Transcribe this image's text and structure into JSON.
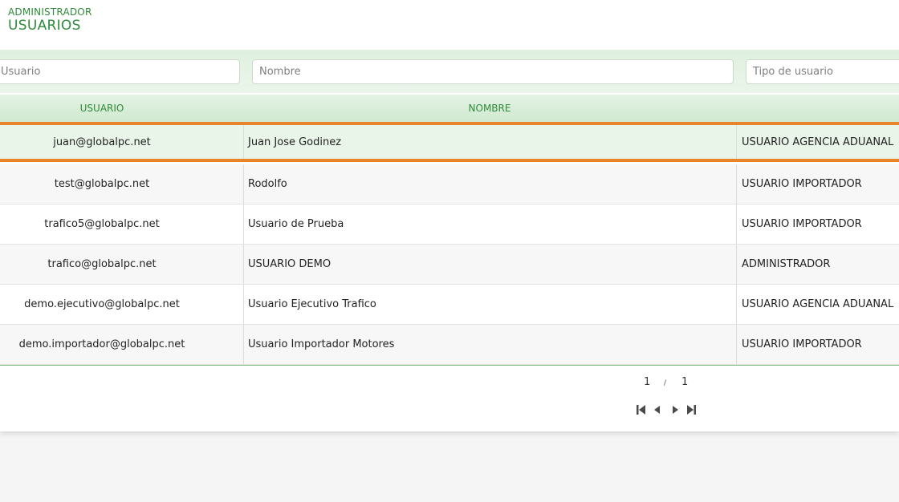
{
  "header": {
    "section": "ADMINISTRADOR",
    "title": "USUARIOS"
  },
  "filters": {
    "usuario_placeholder": "Usuario",
    "nombre_placeholder": "Nombre",
    "tipo_placeholder": "Tipo de usuario"
  },
  "table": {
    "columns": {
      "usuario": "USUARIO",
      "nombre": "NOMBRE"
    },
    "rows": [
      {
        "usuario": "juan@globalpc.net",
        "nombre": "Juan Jose Godinez",
        "tipo": "USUARIO AGENCIA ADUANAL",
        "selected": true
      },
      {
        "usuario": "test@globalpc.net",
        "nombre": "Rodolfo",
        "tipo": "USUARIO IMPORTADOR"
      },
      {
        "usuario": "trafico5@globalpc.net",
        "nombre": "Usuario de Prueba",
        "tipo": "USUARIO IMPORTADOR"
      },
      {
        "usuario": "trafico@globalpc.net",
        "nombre": "USUARIO DEMO",
        "tipo": "ADMINISTRADOR"
      },
      {
        "usuario": "demo.ejecutivo@globalpc.net",
        "nombre": "Usuario Ejecutivo Trafico",
        "tipo": "USUARIO AGENCIA ADUANAL"
      },
      {
        "usuario": "demo.importador@globalpc.net",
        "nombre": "Usuario Importador Motores",
        "tipo": "USUARIO IMPORTADOR"
      }
    ]
  },
  "pagination": {
    "current": "1",
    "separator": "/",
    "total": "1",
    "icons": [
      "first-page-icon",
      "prev-page-icon",
      "next-page-icon",
      "last-page-icon"
    ]
  },
  "colors": {
    "accent_green": "#2e8b3a",
    "selection_border": "#e8852a",
    "selected_row_bg": "#e8f5e8"
  }
}
